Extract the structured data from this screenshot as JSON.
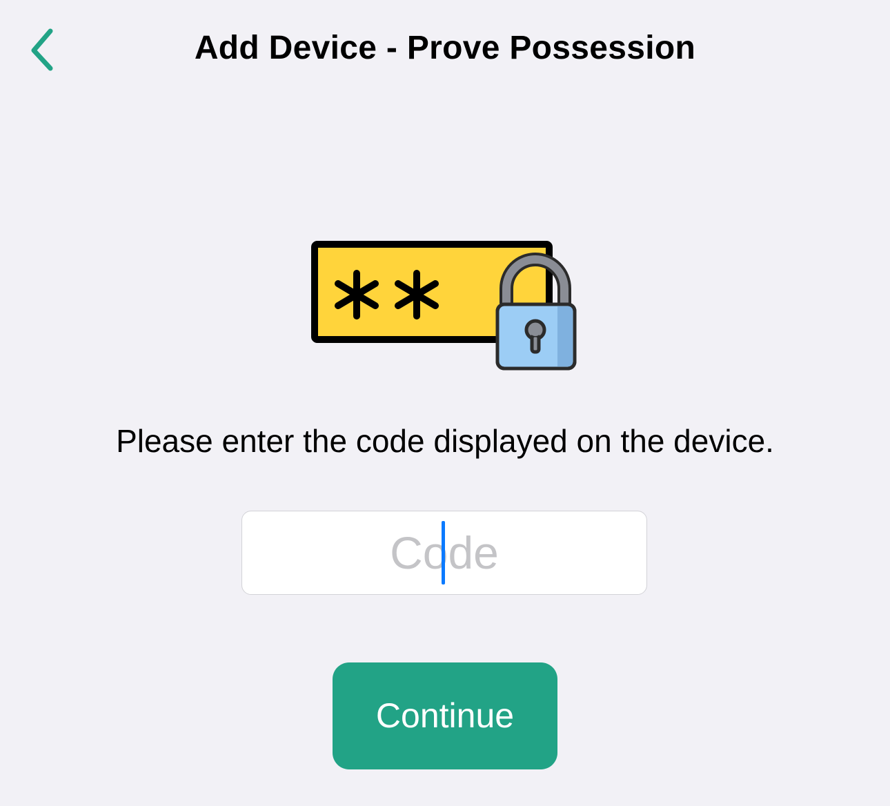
{
  "nav": {
    "title": "Add Device - Prove Possession",
    "back_icon": "chevron-left-icon"
  },
  "illustration": {
    "icon": "password-lock-icon",
    "masked_text": "**"
  },
  "instruction": "Please enter the code displayed on the device.",
  "code_field": {
    "placeholder": "Code",
    "value": ""
  },
  "continue_button": {
    "label": "Continue"
  },
  "colors": {
    "background": "#f2f1f6",
    "accent": "#22a386",
    "caret": "#0a7aff",
    "password_field_fill": "#ffd43b",
    "lock_body": "#9ccdf5"
  }
}
